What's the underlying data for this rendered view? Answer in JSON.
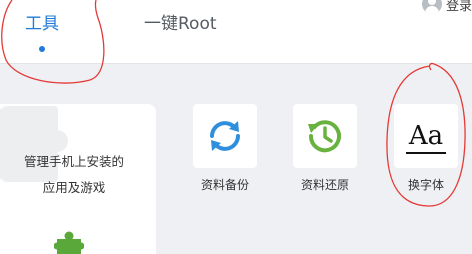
{
  "tabs": [
    {
      "label": "工具",
      "active": true
    },
    {
      "label": "一键Root",
      "active": false
    }
  ],
  "header": {
    "login_label": "登录"
  },
  "app_card": {
    "line1": "管理手机上安装的",
    "line2": "应用及游戏",
    "icon": "puzzle-icon"
  },
  "tools": [
    {
      "label": "资料备份",
      "icon": "sync-arrows-icon"
    },
    {
      "label": "资料还原",
      "icon": "restore-clock-icon"
    },
    {
      "label": "换字体",
      "icon": "font-aa-icon",
      "glyph": "Aa"
    }
  ],
  "colors": {
    "accent": "#1f7bd8",
    "backup_icon": "#2f8fdc",
    "restore_icon": "#6ab23f",
    "puzzle_icon": "#5aa83a",
    "annotation": "#e53935"
  }
}
